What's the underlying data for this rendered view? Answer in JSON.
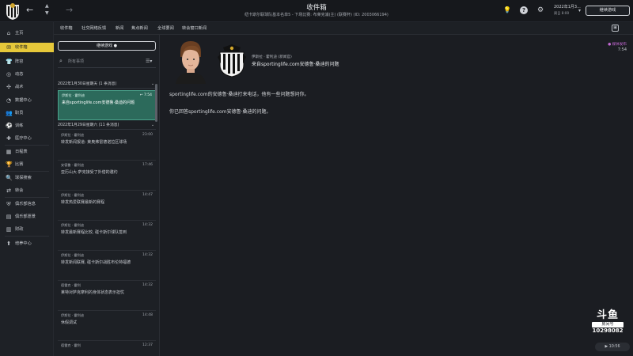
{
  "header": {
    "title": "收件箱",
    "subtitle": "纽卡斯尔联球队基本名单5 - 下场比赛: 布莱克浦(主) (联赛杯)  (ID: 2003066194)",
    "date": "2022年1月3...",
    "time": "周日 8:00",
    "continue_label": "继续游戏"
  },
  "sidebar": {
    "items": [
      {
        "label": "主页",
        "icon": "home-icon"
      },
      {
        "label": "收件箱",
        "icon": "inbox-icon"
      },
      {
        "label": "阵容",
        "icon": "squad-icon"
      },
      {
        "label": "动态",
        "icon": "dynamics-icon"
      },
      {
        "label": "战术",
        "icon": "tactics-icon"
      },
      {
        "label": "数据中心",
        "icon": "data-hub-icon"
      },
      {
        "label": "职员",
        "icon": "staff-icon"
      },
      {
        "label": "训练",
        "icon": "training-icon"
      },
      {
        "label": "医疗中心",
        "icon": "medical-icon"
      },
      {
        "label": "日程表",
        "icon": "schedule-icon"
      },
      {
        "label": "比赛",
        "icon": "competitions-icon"
      },
      {
        "label": "球探搜索",
        "icon": "scouting-icon"
      },
      {
        "label": "转会",
        "icon": "transfers-icon"
      },
      {
        "label": "俱乐部信息",
        "icon": "club-info-icon"
      },
      {
        "label": "俱乐部愿景",
        "icon": "club-vision-icon"
      },
      {
        "label": "财政",
        "icon": "finances-icon"
      },
      {
        "label": "培养中心",
        "icon": "development-icon"
      }
    ]
  },
  "subnav": {
    "items": [
      "收件箱",
      "社交网络反馈",
      "新闻",
      "焦点新闻",
      "全球要闻",
      "转会窗口新闻"
    ]
  },
  "list": {
    "continue_label": "继续游戏",
    "search_placeholder": "所有事项",
    "groups": [
      {
        "header": "2022年1月30日星期天 (1 条消息)"
      },
      {
        "header": "2022年1月29日星期六 (11 条消息)"
      }
    ],
    "messages": [
      {
        "sender": "伊斯拉 · 霍利迪",
        "time": "7:54",
        "subject": "来自sportinglife.com安德鲁·桑迪的问题"
      },
      {
        "sender": "伊斯拉 · 霍利迪",
        "time": "23:00",
        "subject": "转发新闻报道: 莱奥弗雷德诺拉区球场"
      },
      {
        "sender": "安德鲁 · 霍利迪",
        "time": "17:46",
        "subject": "亚历山大·萨克接受了外借的邀约"
      },
      {
        "sender": "伊斯拉 · 霍利迪",
        "time": "14:47",
        "subject": "转发热爱联赛最新的赛程"
      },
      {
        "sender": "伊斯拉 · 霍利迪",
        "time": "14:32",
        "subject": "转发最新赛程比较, 碰卡斯尔球队签到"
      },
      {
        "sender": "伊斯拉 · 霍利迪",
        "time": "14:32",
        "subject": "转发新闻联赛, 碰卡斯尔战胜布伦特福德"
      },
      {
        "sender": "德雷克 · 霍利",
        "time": "14:32",
        "subject": "莱特对萨克摩利的身体状态表示担忧"
      },
      {
        "sender": "伊斯拉 · 霍利迪",
        "time": "14:48",
        "subject": "休假调试"
      },
      {
        "sender": "德雷克 · 霍利",
        "time": "12:37",
        "subject": ""
      }
    ]
  },
  "reader": {
    "meta": "伊斯拉 · 霍利迪  (新闻官)",
    "subject": "来自sportinglife.com安德鲁·桑迪的问题",
    "flag": "● 媒体发布",
    "time": "7:54",
    "body": [
      "sportinglife.com的安德鲁·桑迪打来电话，他有一些问题想问你。",
      "你已回答sportinglife.com安德鲁·桑迪的问题。"
    ]
  },
  "watermark": {
    "logo": "斗鱼",
    "sub": "房间号",
    "id": "10298082",
    "pill": "▶ 10:56"
  }
}
